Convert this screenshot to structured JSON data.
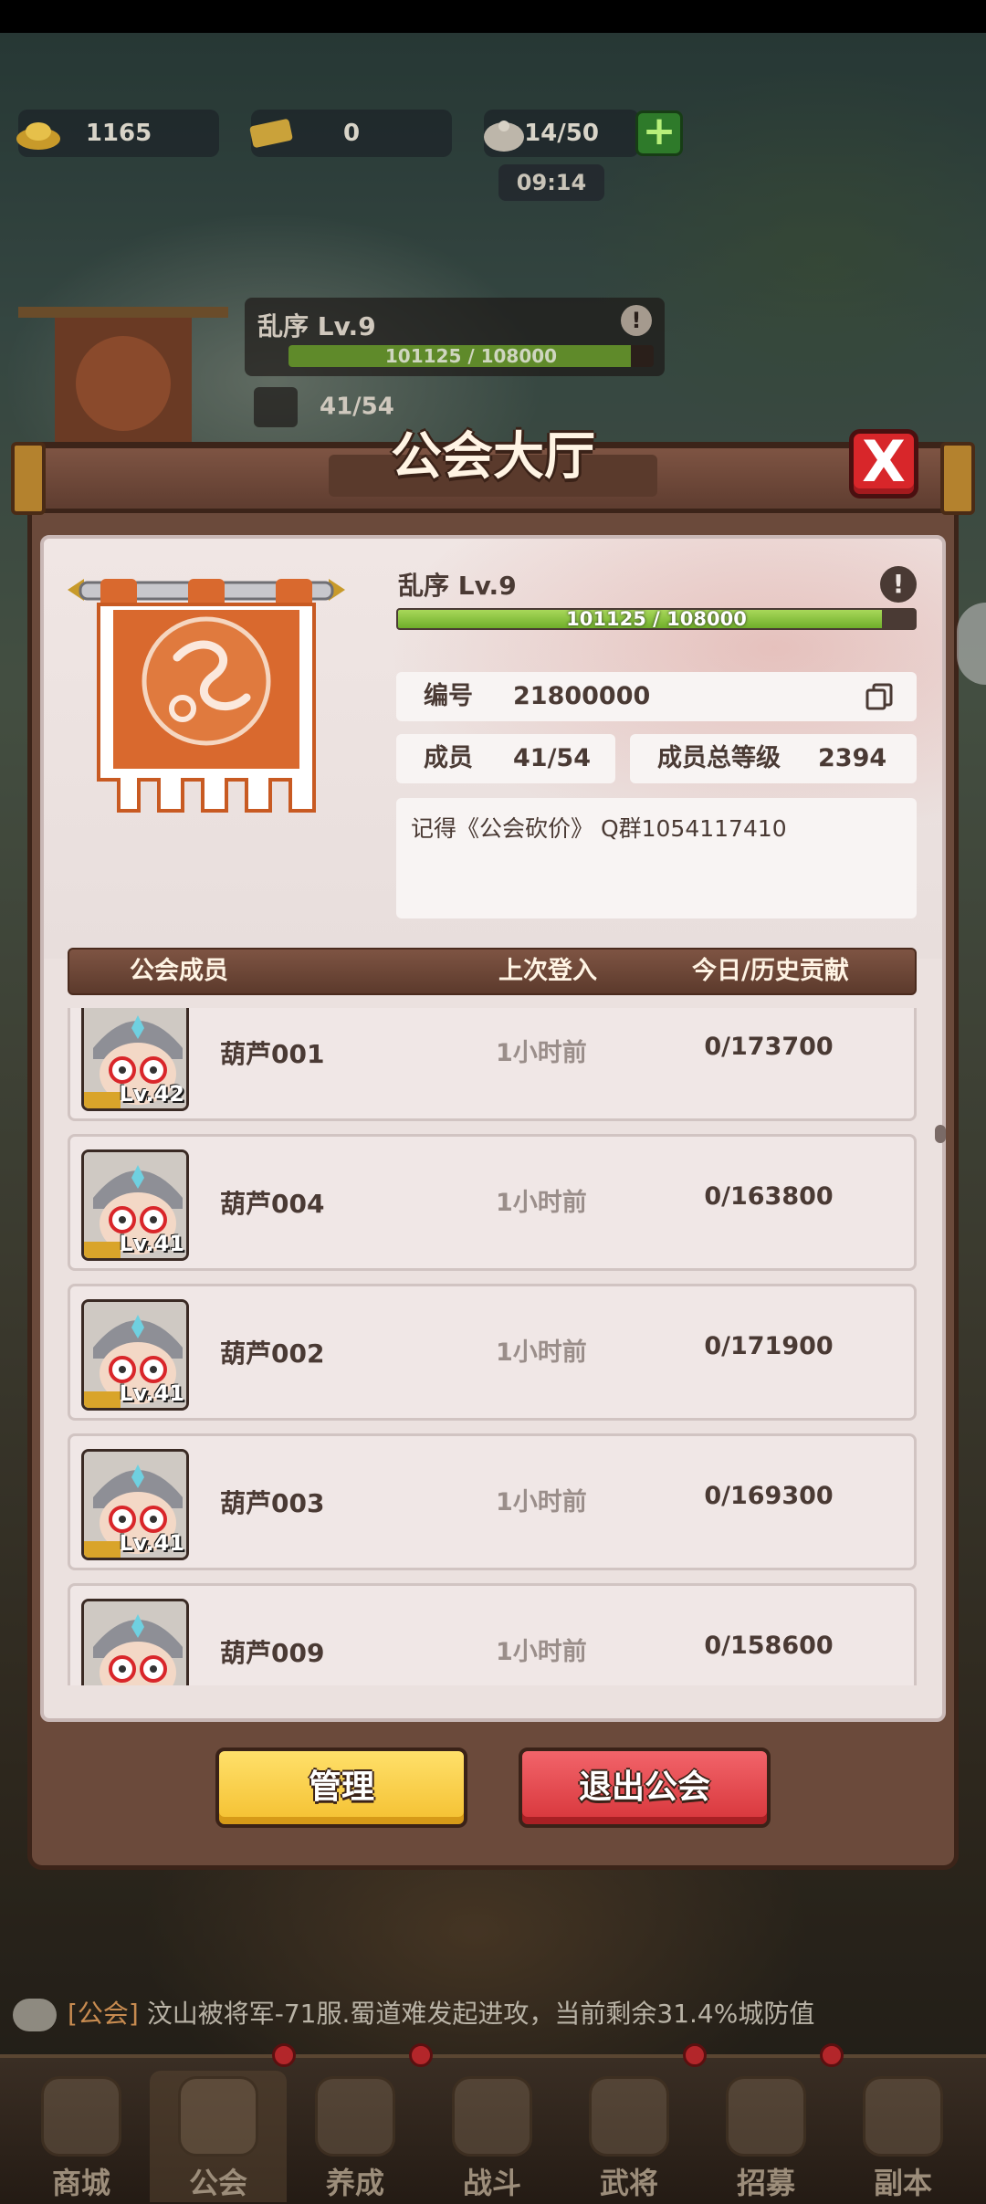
{
  "resources": {
    "gold": "1165",
    "ticket": "0",
    "stamina": "14/50",
    "timer": "09:14"
  },
  "background_guild": {
    "name": "乱序 Lv.9",
    "progress_text": "101125 / 108000",
    "members": "41/54"
  },
  "modal": {
    "title": "公会大厅",
    "close_symbol": "X"
  },
  "guild": {
    "name": "乱序 Lv.9",
    "warn_symbol": "!",
    "exp_text": "101125 / 108000",
    "exp_progress": 0.937,
    "id_label": "编号",
    "id_value": "21800000",
    "members_label": "成员",
    "members_value": "41/54",
    "total_level_label": "成员总等级",
    "total_level_value": "2394",
    "notice": "记得《公会砍价》 Q群1054117410"
  },
  "table": {
    "col_member": "公会成员",
    "col_last_login": "上次登入",
    "col_contribution": "今日/历史贡献"
  },
  "members": [
    {
      "name": "葫芦001",
      "level": "Lv.42",
      "last_login": "1小时前",
      "contribution": "0/173700"
    },
    {
      "name": "葫芦004",
      "level": "Lv.41",
      "last_login": "1小时前",
      "contribution": "0/163800"
    },
    {
      "name": "葫芦002",
      "level": "Lv.41",
      "last_login": "1小时前",
      "contribution": "0/171900"
    },
    {
      "name": "葫芦003",
      "level": "Lv.41",
      "last_login": "1小时前",
      "contribution": "0/169300"
    },
    {
      "name": "葫芦009",
      "level": "",
      "last_login": "1小时前",
      "contribution": "0/158600"
    }
  ],
  "buttons": {
    "manage": "管理",
    "quit": "退出公会"
  },
  "chat": {
    "tag": "[公会]",
    "message": "汶山被将军-71服.蜀道难发起进攻，当前剩余31.4%城防值"
  },
  "nav": [
    "商城",
    "公会",
    "养成",
    "战斗",
    "武将",
    "招募",
    "副本"
  ],
  "colors": {
    "accent_brown": "#6b4a3b",
    "progress_green": "#7fbf35",
    "manage_yellow": "#f4c030",
    "quit_red": "#d7353a",
    "banner_orange": "#d9692e"
  }
}
